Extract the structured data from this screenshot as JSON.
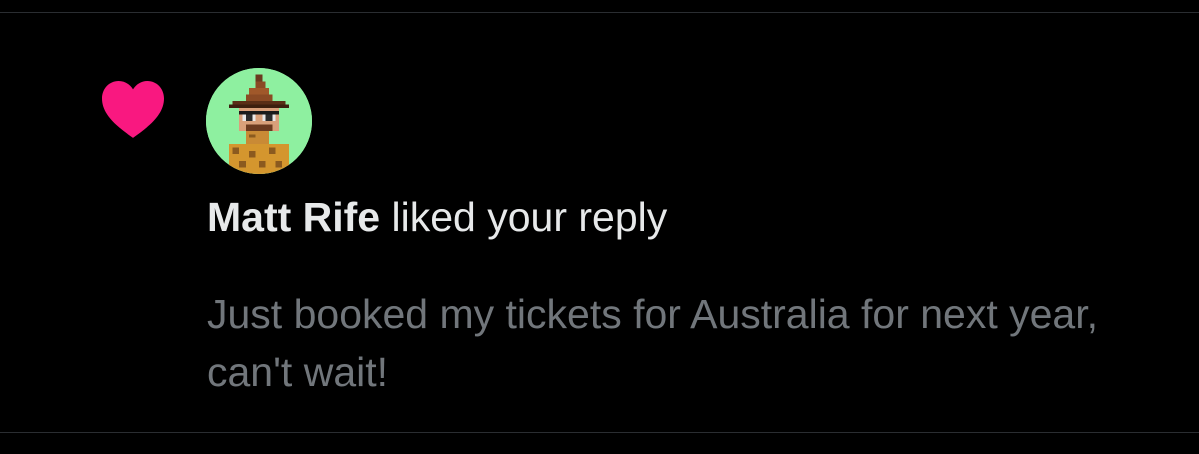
{
  "notification": {
    "type_icon": "heart-icon",
    "icon_color": "#f91880",
    "avatar_icon": "pixel-art-avatar",
    "user_name": "Matt Rife",
    "action_text": " liked your reply",
    "reply_text": "Just booked my tickets for Australia for next year, can't wait!"
  },
  "colors": {
    "background": "#000000",
    "primary_text": "#e7e9ea",
    "secondary_text": "#71767b",
    "divider": "#2a2d31",
    "avatar_background": "#8ef0a0"
  }
}
